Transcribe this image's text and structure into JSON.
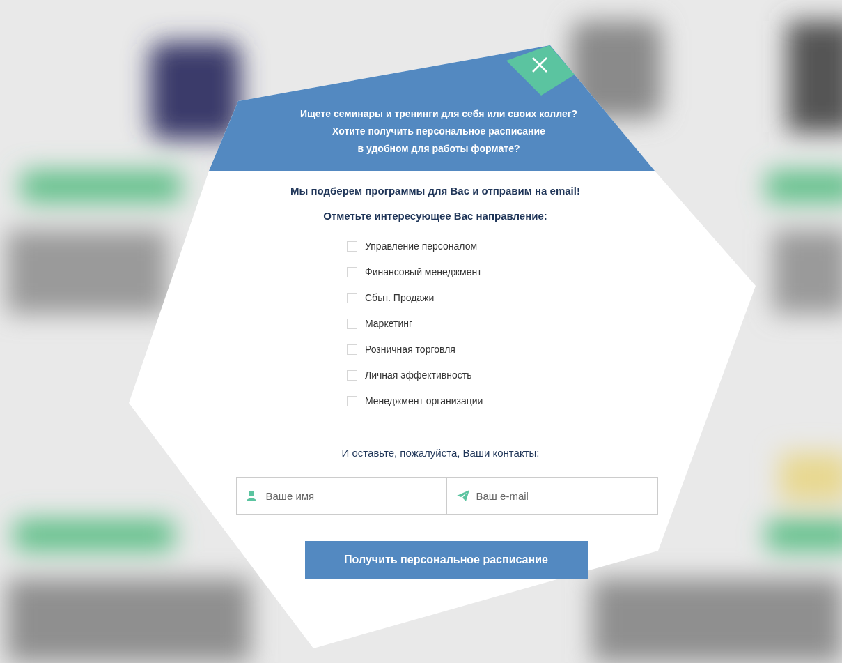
{
  "popup": {
    "header_lines": [
      "Ищете семинары и тренинги для себя или своих коллег?",
      "Хотите получить персональное расписание",
      "в удобном для работы формате?"
    ],
    "intro": "Мы подберем программы для Вас и отправим на email!",
    "prompt": "Отметьте интересующее Вас направление:",
    "directions": [
      {
        "label": "Управление персоналом",
        "checked": false
      },
      {
        "label": "Финансовый менеджмент",
        "checked": false
      },
      {
        "label": "Сбыт. Продажи",
        "checked": false
      },
      {
        "label": "Маркетинг",
        "checked": false
      },
      {
        "label": "Розничная торговля",
        "checked": false
      },
      {
        "label": "Личная эффективность",
        "checked": false
      },
      {
        "label": "Менеджмент организации",
        "checked": false
      }
    ],
    "contacts_prompt": "И оставьте, пожалуйста, Ваши контакты:",
    "fields": [
      {
        "kind": "name",
        "placeholder": "Ваше имя"
      },
      {
        "kind": "email",
        "placeholder": "Ваш e-mail"
      }
    ],
    "submit_button": "Получить персональное расписание"
  }
}
